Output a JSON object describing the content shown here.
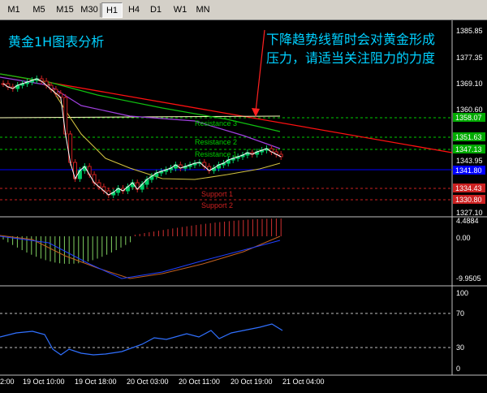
{
  "toolbar": {
    "timeframes": [
      "M1",
      "M5",
      "M15",
      "M30",
      "H1",
      "H4",
      "D1",
      "W1",
      "MN"
    ],
    "active": "H1"
  },
  "chart": {
    "title": "黄金1H图表分析",
    "annotation_line1": "下降趋势线暂时会对黄金形成",
    "annotation_line2": "压力，请适当关注阻力的力度",
    "price_axis": [
      "1385.85",
      "1377.35",
      "1369.10",
      "1360.60",
      "1343.95",
      "1327.10"
    ],
    "levels": [
      {
        "label": "Resistance 3",
        "price": "1358.07",
        "color": "#00cc00"
      },
      {
        "label": "Resistance 2",
        "price": "1351.63",
        "color": "#00cc00"
      },
      {
        "label": "Resistance 1",
        "price": "1347.13",
        "color": "#00cc00"
      },
      {
        "label": "Support 1",
        "price": "1334.43",
        "color": "#cc2020"
      },
      {
        "label": "Support 2",
        "price": "1330.80",
        "color": "#cc2020"
      }
    ],
    "current_price": "1341.80",
    "macd_axis": [
      "4.4884",
      "0.00",
      "-9.9505"
    ],
    "rsi_axis": [
      "100",
      "70",
      "30",
      "0"
    ],
    "time_axis": [
      "2:00",
      "19 Oct 10:00",
      "19 Oct 18:00",
      "20 Oct 03:00",
      "20 Oct 11:00",
      "20 Oct 19:00",
      "21 Oct 04:00"
    ],
    "colors": {
      "bull": "#00cc66",
      "bear": "#cc2020",
      "axis": "#ffffff",
      "current": "#0000ff"
    }
  }
}
